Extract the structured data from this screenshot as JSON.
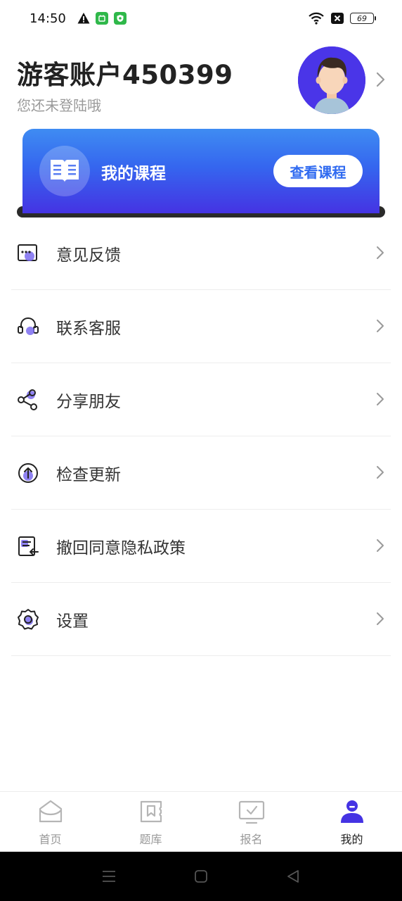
{
  "status_bar": {
    "time": "14:50",
    "battery": "69",
    "icons": [
      "warning-icon",
      "app-badge-green-icon",
      "shield-badge-icon",
      "wifi-icon",
      "no-sim-icon",
      "battery-icon"
    ]
  },
  "profile": {
    "name": "游客账户450399",
    "subtitle": "您还未登陆哦"
  },
  "course_card": {
    "title": "我的课程",
    "button_label": "查看课程"
  },
  "menu": {
    "items": [
      {
        "label": "意见反馈",
        "icon": "feedback-icon"
      },
      {
        "label": "联系客服",
        "icon": "headset-icon"
      },
      {
        "label": "分享朋友",
        "icon": "share-icon"
      },
      {
        "label": "检查更新",
        "icon": "update-icon"
      },
      {
        "label": "撤回同意隐私政策",
        "icon": "privacy-revoke-icon"
      },
      {
        "label": "设置",
        "icon": "settings-icon"
      }
    ]
  },
  "tabs": [
    {
      "label": "首页",
      "icon": "home-icon",
      "active": false
    },
    {
      "label": "题库",
      "icon": "question-bank-icon",
      "active": false
    },
    {
      "label": "报名",
      "icon": "register-icon",
      "active": false
    },
    {
      "label": "我的",
      "icon": "profile-icon",
      "active": true
    }
  ],
  "colors": {
    "accent": "#4533e3",
    "card_gradient_top": "#3f8cf2",
    "card_gradient_bottom": "#4533e3",
    "icon_accent": "#7b6cf0"
  }
}
